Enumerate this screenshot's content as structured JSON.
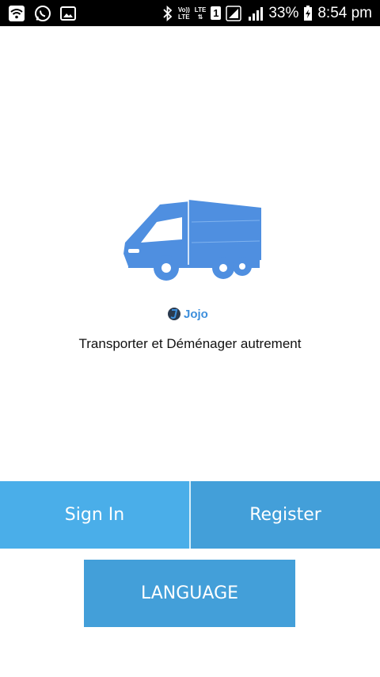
{
  "status_bar": {
    "volte_label_top": "Vo))",
    "volte_label_bottom": "LTE",
    "lte_label": "LTE",
    "sim_slot": "1",
    "battery_percent": "33%",
    "time": "8:54 pm",
    "icons": [
      "wifi-icon",
      "whatsapp-icon",
      "image-icon",
      "bluetooth-icon",
      "signal-icon",
      "battery-icon"
    ]
  },
  "app": {
    "logo_text": "Jojo",
    "tagline": "Transporter et Déménager autrement"
  },
  "buttons": {
    "sign_in": "Sign In",
    "register": "Register",
    "language": "LANGUAGE"
  },
  "colors": {
    "truck": "#4f8fe0",
    "sign_in_bg": "#4aaee9",
    "register_bg": "#439fd9",
    "language_bg": "#439fd9"
  }
}
